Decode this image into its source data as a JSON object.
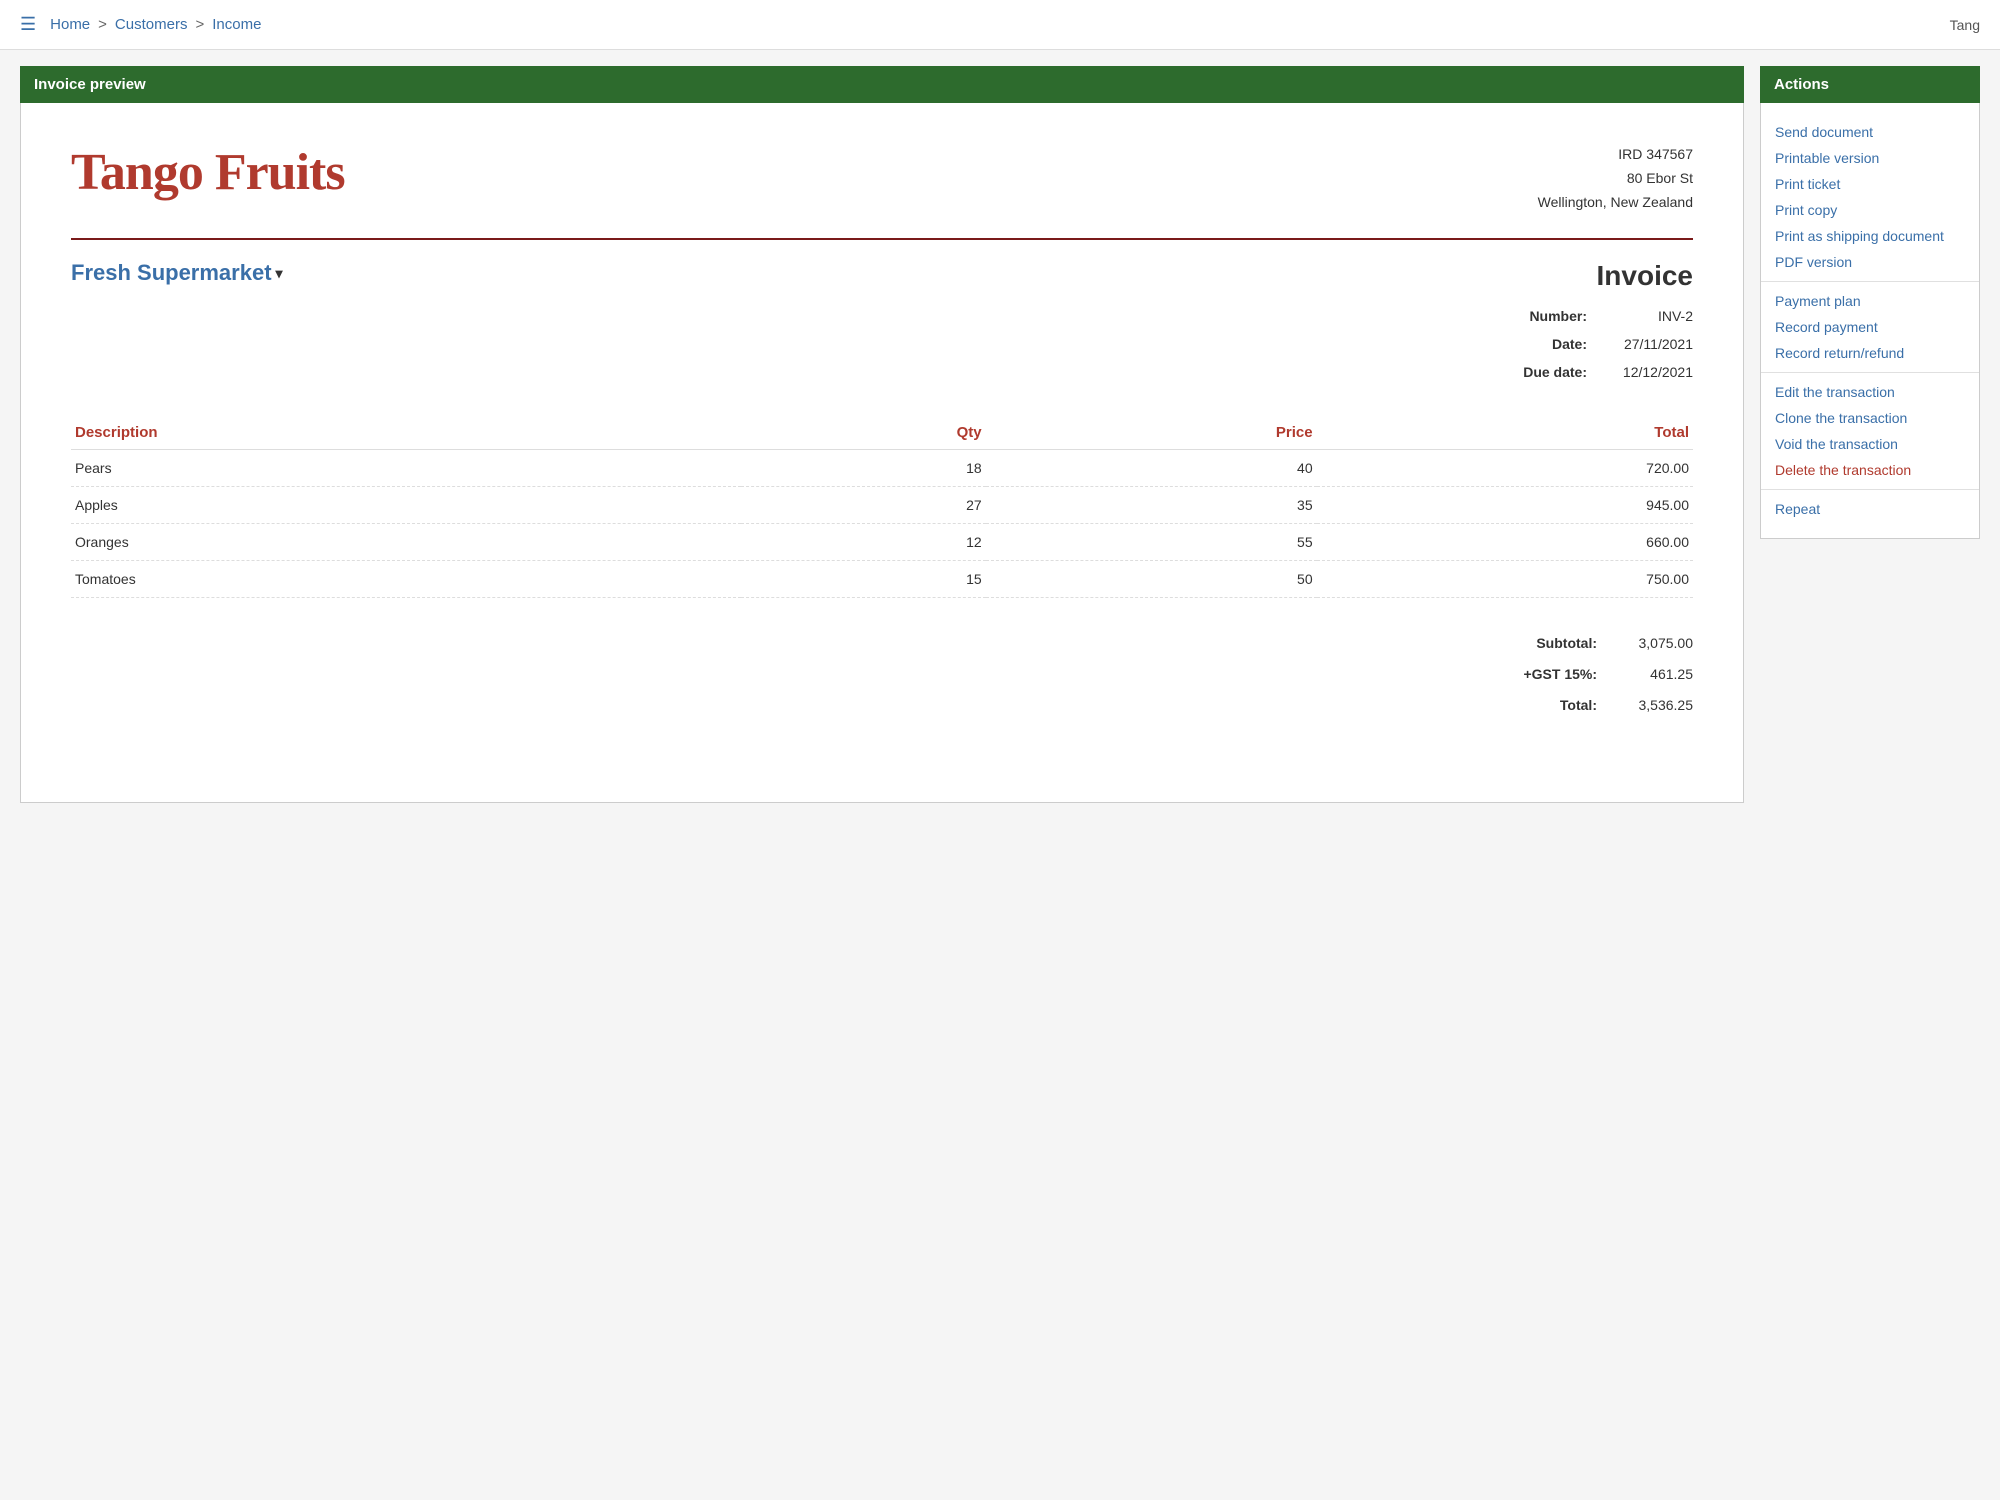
{
  "topNav": {
    "hamburger": "☰",
    "breadcrumbs": [
      {
        "label": "Home",
        "active": false
      },
      {
        "label": "Customers",
        "active": false
      },
      {
        "label": "Income",
        "active": true
      }
    ],
    "separator": ">",
    "userLabel": "Tang"
  },
  "invoicePanel": {
    "header": "Invoice preview",
    "company": {
      "name": "Tango Fruits",
      "ird": "IRD 347567",
      "address1": "80 Ebor St",
      "address2": "Wellington, New Zealand"
    },
    "customer": {
      "name": "Fresh Supermarket"
    },
    "invoiceTitle": "Invoice",
    "details": {
      "numberLabel": "Number:",
      "numberValue": "INV-2",
      "dateLabel": "Date:",
      "dateValue": "27/11/2021",
      "dueDateLabel": "Due date:",
      "dueDateValue": "12/12/2021"
    },
    "table": {
      "headers": {
        "description": "Description",
        "qty": "Qty",
        "price": "Price",
        "total": "Total"
      },
      "rows": [
        {
          "description": "Pears",
          "qty": "18",
          "price": "40",
          "total": "720.00"
        },
        {
          "description": "Apples",
          "qty": "27",
          "price": "35",
          "total": "945.00"
        },
        {
          "description": "Oranges",
          "qty": "12",
          "price": "55",
          "total": "660.00"
        },
        {
          "description": "Tomatoes",
          "qty": "15",
          "price": "50",
          "total": "750.00"
        }
      ]
    },
    "totals": {
      "subtotalLabel": "Subtotal:",
      "subtotalValue": "3,075.00",
      "gstLabel": "+GST 15%:",
      "gstValue": "461.25",
      "totalLabel": "Total:",
      "totalValue": "3,536.25"
    }
  },
  "actionsPanel": {
    "header": "Actions",
    "groups": [
      {
        "items": [
          {
            "label": "Send document",
            "danger": false
          },
          {
            "label": "Printable version",
            "danger": false
          },
          {
            "label": "Print ticket",
            "danger": false
          },
          {
            "label": "Print copy",
            "danger": false
          },
          {
            "label": "Print as shipping document",
            "danger": false
          },
          {
            "label": "PDF version",
            "danger": false
          }
        ]
      },
      {
        "items": [
          {
            "label": "Payment plan",
            "danger": false
          },
          {
            "label": "Record payment",
            "danger": false
          },
          {
            "label": "Record return/refund",
            "danger": false
          }
        ]
      },
      {
        "items": [
          {
            "label": "Edit the transaction",
            "danger": false
          },
          {
            "label": "Clone the transaction",
            "danger": false
          },
          {
            "label": "Void the transaction",
            "danger": false
          },
          {
            "label": "Delete the transaction",
            "danger": true
          }
        ]
      },
      {
        "items": [
          {
            "label": "Repeat",
            "danger": false
          }
        ]
      }
    ]
  }
}
